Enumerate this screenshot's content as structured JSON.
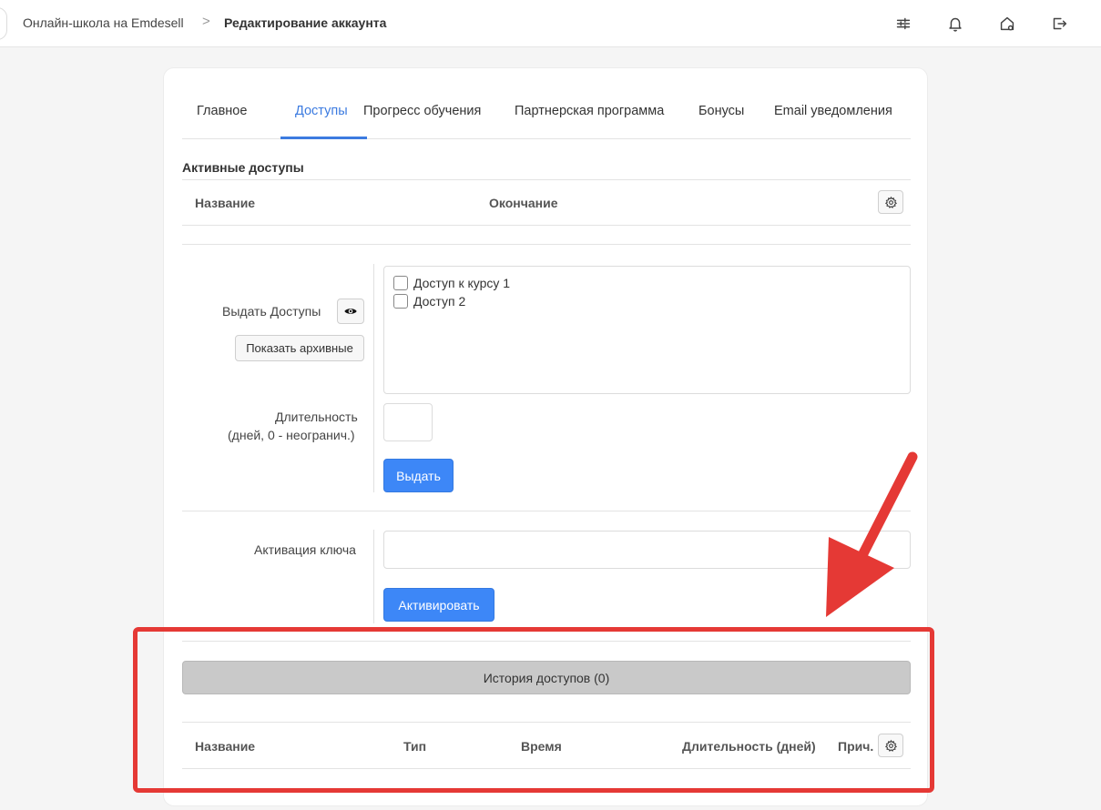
{
  "breadcrumb": {
    "school": "Онлайн-школа на Emdesell",
    "separator": ">",
    "current": "Редактирование аккаунта"
  },
  "topbar_icons": [
    "sliders-icon",
    "bell-icon",
    "home-settings-icon",
    "logout-icon"
  ],
  "tabs": [
    {
      "label": "Главное",
      "active": false
    },
    {
      "label": "Доступы",
      "active": true
    },
    {
      "label": "Прогресс обучения",
      "active": false
    },
    {
      "label": "Партнерская программа",
      "active": false
    },
    {
      "label": "Бонусы",
      "active": false
    },
    {
      "label": "Email уведомления",
      "active": false
    }
  ],
  "active_access": {
    "title": "Активные доступы",
    "columns": [
      "Название",
      "Окончание"
    ]
  },
  "grant": {
    "label": "Выдать Доступы",
    "show_archived": "Показать архивные",
    "options": [
      {
        "label": "Доступ к курсу 1",
        "checked": false
      },
      {
        "label": "Доступ 2",
        "checked": false
      }
    ],
    "duration_label_line1": "Длительность",
    "duration_label_line2": "(дней, 0 - неогранич.)",
    "duration_value": "",
    "submit": "Выдать"
  },
  "key_activation": {
    "label": "Активация ключа",
    "value": "",
    "submit": "Активировать"
  },
  "history": {
    "button": "История доступов (0)",
    "columns": [
      "Название",
      "Тип",
      "Время",
      "Длительность (дней)",
      "Прич."
    ]
  },
  "colors": {
    "accent": "#3c7be0",
    "primary_button": "#3d87f7",
    "annotation": "#e53935"
  }
}
